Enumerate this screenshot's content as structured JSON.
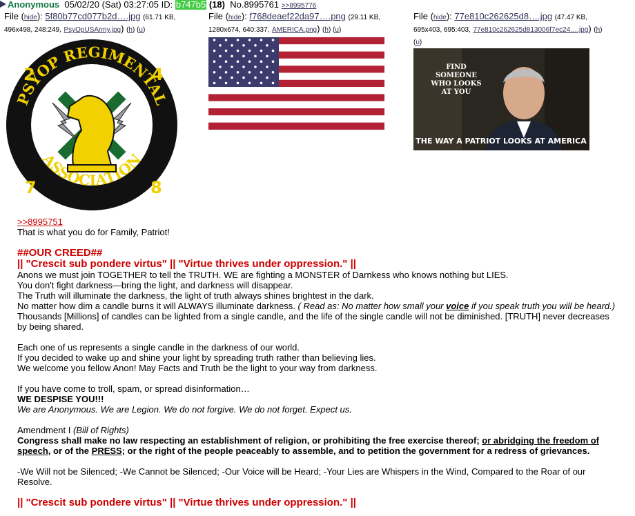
{
  "post": {
    "name": "Anonymous",
    "datetime": "05/02/20 (Sat) 03:27:05",
    "id_label": "ID:",
    "id": "b747b5",
    "id_color": "#44cc44",
    "post_count": "(18)",
    "number": "No.8995761",
    "backlink": ">>8995776"
  },
  "files": [
    {
      "label": "File",
      "hide": "hide",
      "filename": "5f80b77cd077b2d….jpg",
      "size": "(61.71 KB,",
      "dims": "496x498, 248:249,",
      "orig": "PsyOpUSArmy.jpg",
      "h": "h",
      "u": "u",
      "text_top": "PSYOP REGIMENTAL",
      "text_bottom": "ASSOCIATION",
      "n1": "2",
      "n2": "4",
      "n3": "7",
      "n4": "8"
    },
    {
      "label": "File",
      "hide": "hide",
      "filename": "f768deaef22da97….png",
      "size": "(29.11 KB,",
      "dims": "1280x674, 640:337,",
      "orig": "AMERICA.png",
      "h": "h",
      "u": "u"
    },
    {
      "label": "File",
      "hide": "hide",
      "filename": "77e810c262625d8….jpg",
      "size": "(47.47 KB,",
      "dims": "695x403, 695:403,",
      "orig": "77e810c262625d813006f7ec24….jpg",
      "h": "h",
      "u": "u",
      "caption_top1": "FIND",
      "caption_top2": "SOMEONE",
      "caption_top3": "WHO LOOKS",
      "caption_top4": "AT YOU",
      "caption_bottom": "THE WAY A PATRIOT LOOKS AT AMERICA"
    }
  ],
  "body": {
    "reply_link": ">>8995751",
    "l1": "That is what you do for Family, Patriot!",
    "h1": "##OUR CREED##",
    "h2": "|| \"Crescit sub pondere virtus\" || \"Virtue thrives under oppression.\" ||",
    "l2": "Anons we must join TOGETHER to tell the TRUTH. WE are fighting a MONSTER of Darnkess who knows nothing but LIES.",
    "l3": "You don't fight darkness—bring the light, and darkness will disappear.",
    "l4": "The Truth will illuminate the darkness, the light of truth always shines brightest in the dark.",
    "l5a": "No matter how dim a candle burns it will ALWAYS illuminate darkness. ",
    "l5b": "( Read as: No matter how small your ",
    "l5c": "voice",
    "l5d": " if you speak truth you will be heard.)",
    "l6": "Thousands [Millions] of candles can be lighted from a single candle, and the life of the single candle will not be diminished. [TRUTH] never decreases by being shared.",
    "l7": "Each one of us represents a single candle in the darkness of our world.",
    "l8": "If you decided to wake up and shine your light by spreading truth rather than believing lies.",
    "l9": "We welcome you fellow Anon! May Facts and Truth be the light to your way from darkness.",
    "l10": "If you have come to troll, spam, or spread disinformation…",
    "l11": "WE DESPISE YOU!!!",
    "l12": "We are Anonymous. We are Legion. We do not forgive. We do not forget. Expect us.",
    "l13a": "Amendment I ",
    "l13b": "(Bill of Rights)",
    "l14a": "Congress shall make no law respecting an establishment of religion, or prohibiting the free exercise thereof; ",
    "l14b": "or abridging the freedom of speech",
    "l14c": ", or of the ",
    "l14d": "PRESS",
    "l14e": "; or the right of the people peaceably to assemble, and to petition the government for a redress of grievances.",
    "l15": "-We Will not be Silenced;  -We Cannot be Silenced;  -Our Voice will be Heard;   -Your Lies are Whispers in the Wind, Compared to the Roar of our Resolve.",
    "h3": "|| \"Crescit sub pondere virtus\" || \"Virtue thrives under oppression.\" ||"
  }
}
